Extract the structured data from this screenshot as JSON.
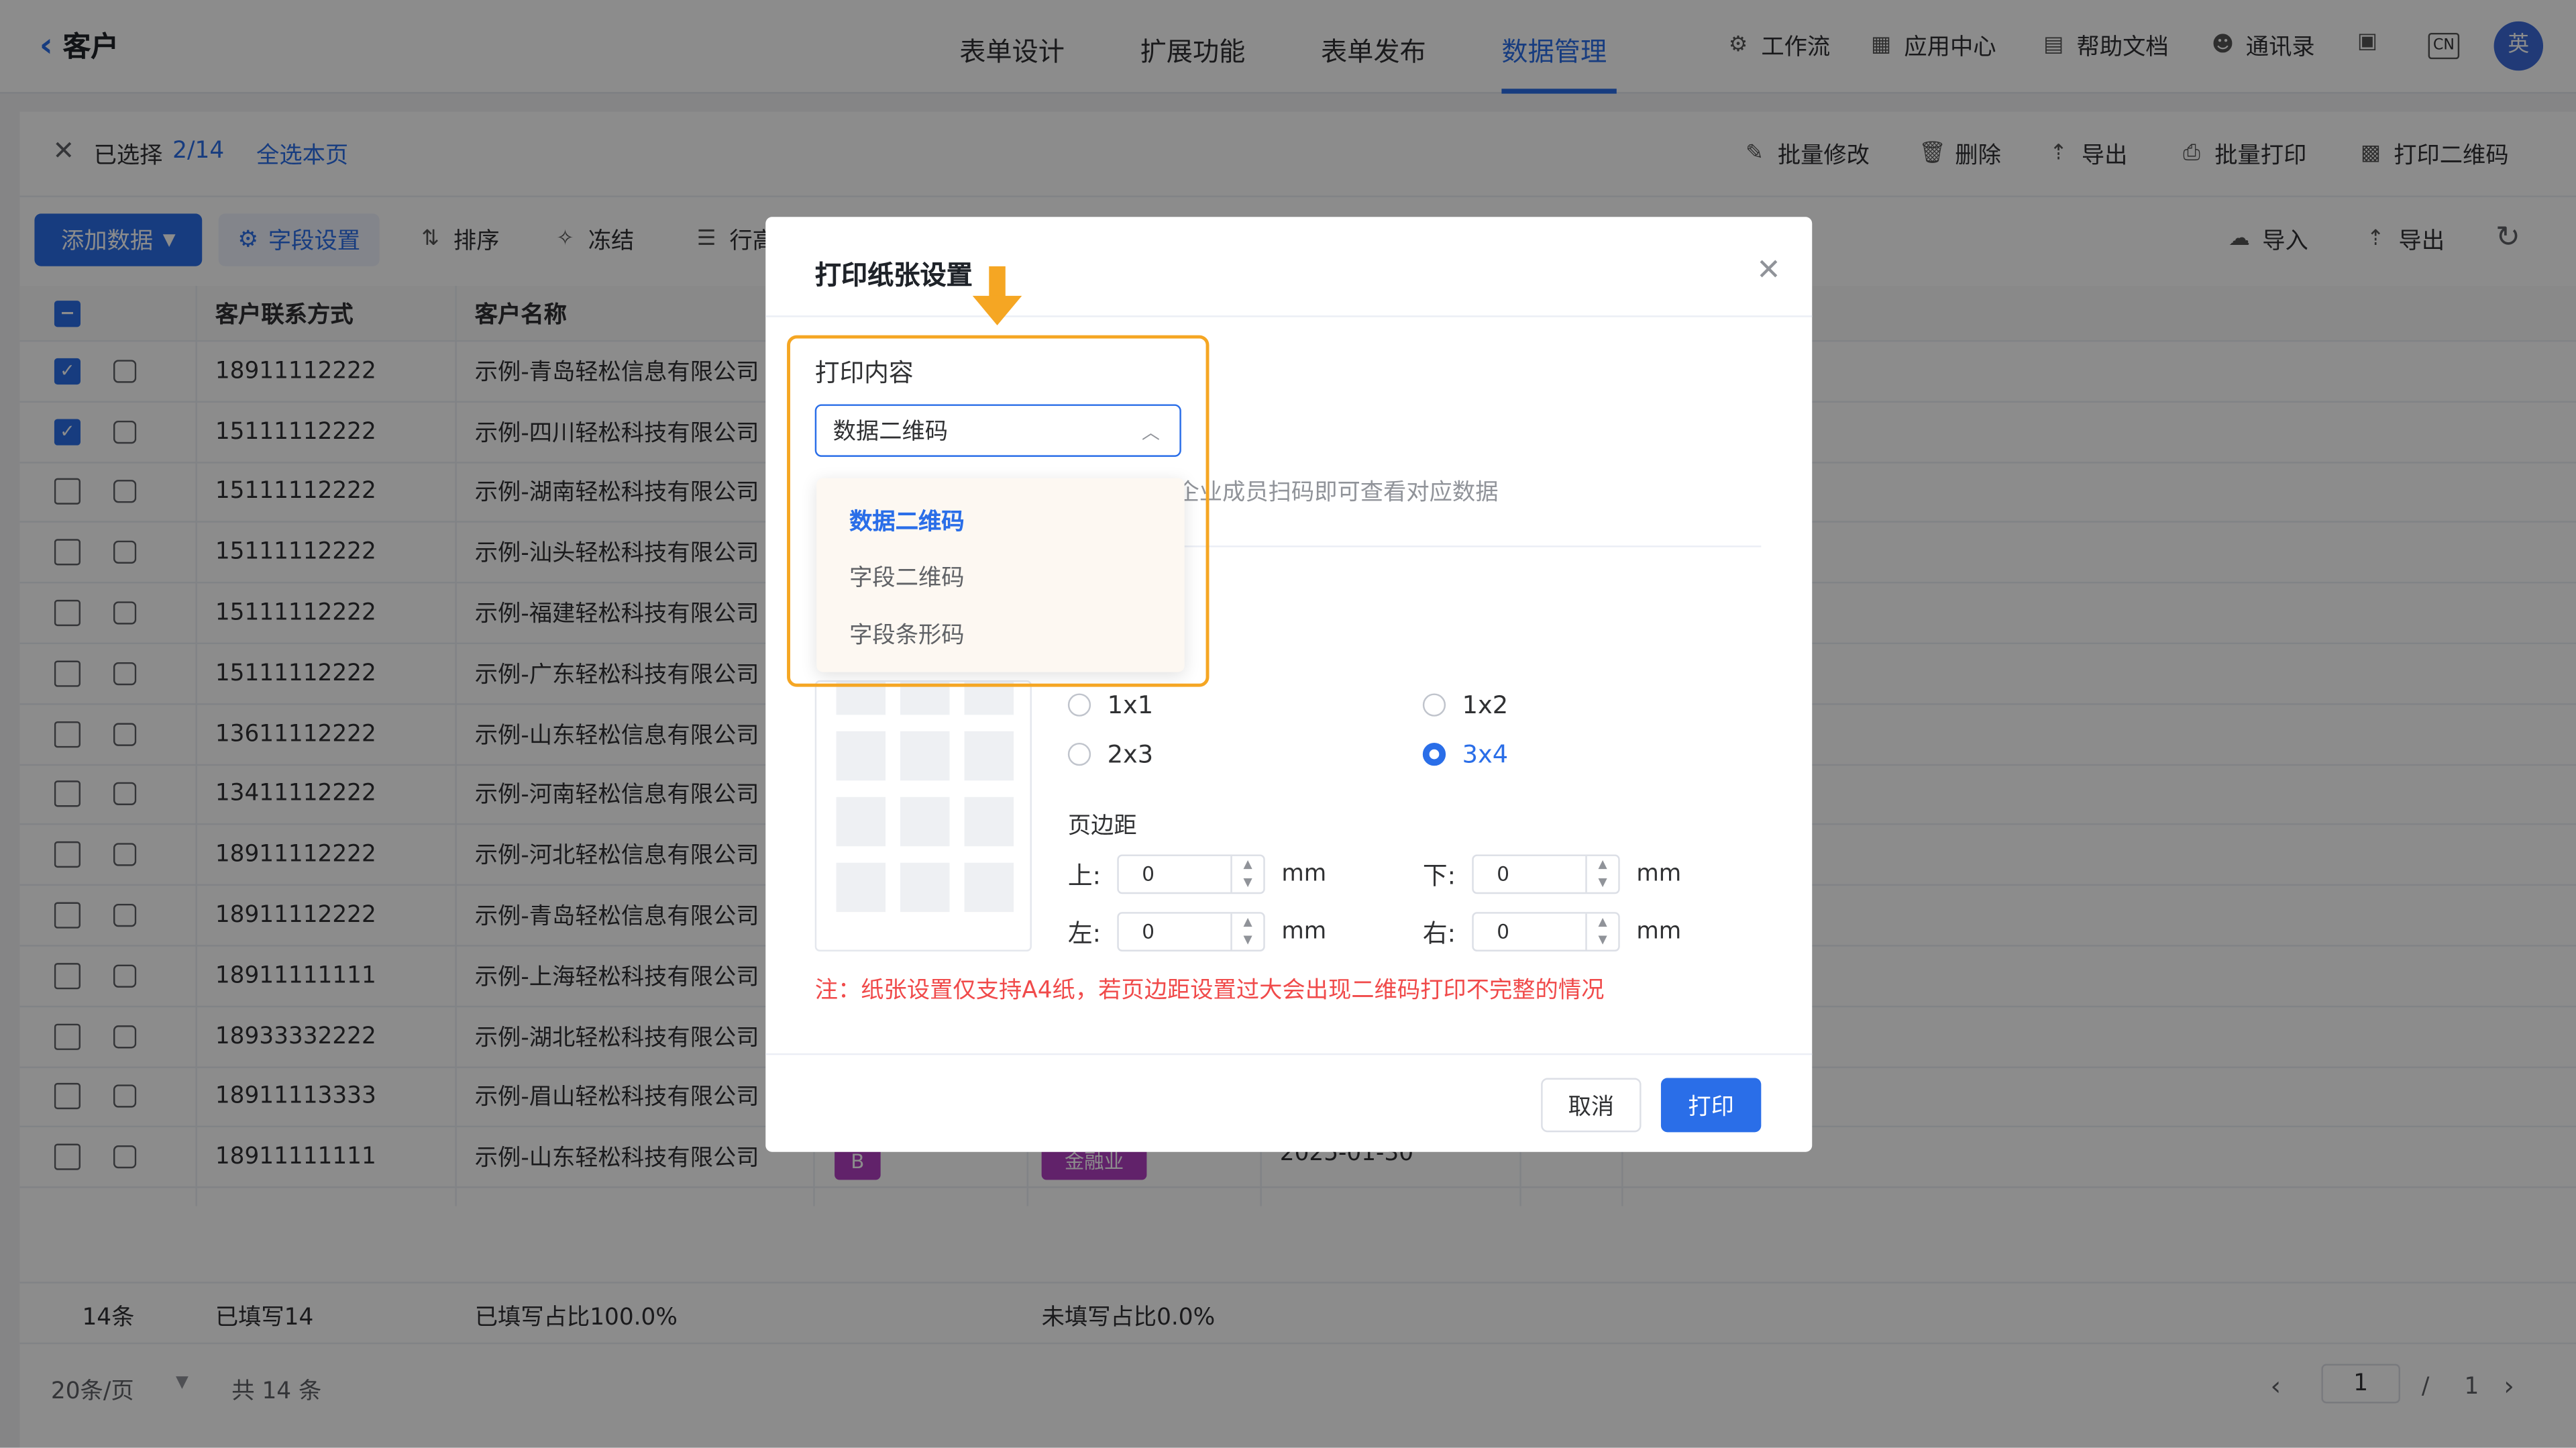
{
  "app": {
    "back_title": "客户"
  },
  "nav": {
    "tabs": [
      "表单设计",
      "扩展功能",
      "表单发布",
      "数据管理"
    ],
    "active_index": 3
  },
  "header_tools": [
    "工作流",
    "应用中心",
    "帮助文档",
    "通讯录"
  ],
  "header_badge": "CN",
  "avatar_text": "英",
  "selection": {
    "prefix": "已选择",
    "count": "2/14",
    "select_page": "全选本页"
  },
  "batch_actions": [
    "批量修改",
    "删除",
    "导出",
    "批量打印",
    "打印二维码"
  ],
  "toolbar": {
    "add_data": "添加数据",
    "field_settings": "字段设置",
    "sort": "排序",
    "freeze": "冻结",
    "row_height": "行高",
    "import": "导入",
    "export": "导出"
  },
  "table": {
    "headers": {
      "contact": "客户联系方式",
      "name": "客户名称"
    },
    "rows": [
      {
        "checked": true,
        "phone": "18911112222",
        "name": "示例-青岛轻松信息有限公司"
      },
      {
        "checked": true,
        "phone": "15111112222",
        "name": "示例-四川轻松科技有限公司"
      },
      {
        "checked": false,
        "phone": "15111112222",
        "name": "示例-湖南轻松科技有限公司"
      },
      {
        "checked": false,
        "phone": "15111112222",
        "name": "示例-汕头轻松科技有限公司"
      },
      {
        "checked": false,
        "phone": "15111112222",
        "name": "示例-福建轻松科技有限公司"
      },
      {
        "checked": false,
        "phone": "15111112222",
        "name": "示例-广东轻松科技有限公司"
      },
      {
        "checked": false,
        "phone": "13611112222",
        "name": "示例-山东轻松信息有限公司"
      },
      {
        "checked": false,
        "phone": "13411112222",
        "name": "示例-河南轻松信息有限公司"
      },
      {
        "checked": false,
        "phone": "18911112222",
        "name": "示例-河北轻松信息有限公司"
      },
      {
        "checked": false,
        "phone": "18911112222",
        "name": "示例-青岛轻松信息有限公司"
      },
      {
        "checked": false,
        "phone": "18911111111",
        "name": "示例-上海轻松科技有限公司"
      },
      {
        "checked": false,
        "phone": "18933332222",
        "name": "示例-湖北轻松科技有限公司"
      },
      {
        "checked": false,
        "phone": "18911113333",
        "name": "示例-眉山轻松科技有限公司"
      },
      {
        "checked": false,
        "phone": "18911111111",
        "name": "示例-山东轻松科技有限公司"
      }
    ],
    "partial_last_row": {
      "tag_b": "B",
      "tag_industry": "金融业",
      "date": "2025-01-30"
    },
    "summary": {
      "count": "14条",
      "filled": "已填写14",
      "filled_ratio": "已填写占比100.0%",
      "unfilled_ratio": "未填写占比0.0%"
    }
  },
  "pagination": {
    "page_size": "20条/页",
    "total": "共 14 条",
    "current": "1",
    "sep": "/",
    "pages": "1"
  },
  "modal": {
    "title": "打印纸张设置",
    "print_content_label": "打印内容",
    "selected_option": "数据二维码",
    "options": [
      "数据二维码",
      "字段二维码",
      "字段条形码"
    ],
    "hint": "企业成员扫码即可查看对应数据",
    "layouts": [
      {
        "label": "1x1",
        "checked": false
      },
      {
        "label": "1x2",
        "checked": false
      },
      {
        "label": "2x3",
        "checked": false
      },
      {
        "label": "3x4",
        "checked": true
      }
    ],
    "margin_label": "页边距",
    "margins": {
      "top": {
        "label": "上:",
        "value": "0",
        "unit": "mm"
      },
      "bottom": {
        "label": "下:",
        "value": "0",
        "unit": "mm"
      },
      "left": {
        "label": "左:",
        "value": "0",
        "unit": "mm"
      },
      "right": {
        "label": "右:",
        "value": "0",
        "unit": "mm"
      }
    },
    "note": "注：纸张设置仅支持A4纸，若页边距设置过大会出现二维码打印不完整的情况",
    "cancel": "取消",
    "print": "打印"
  },
  "colors": {
    "accent": "#2a6ee8",
    "highlight": "#f5a623",
    "warning": "#f04a4a"
  }
}
